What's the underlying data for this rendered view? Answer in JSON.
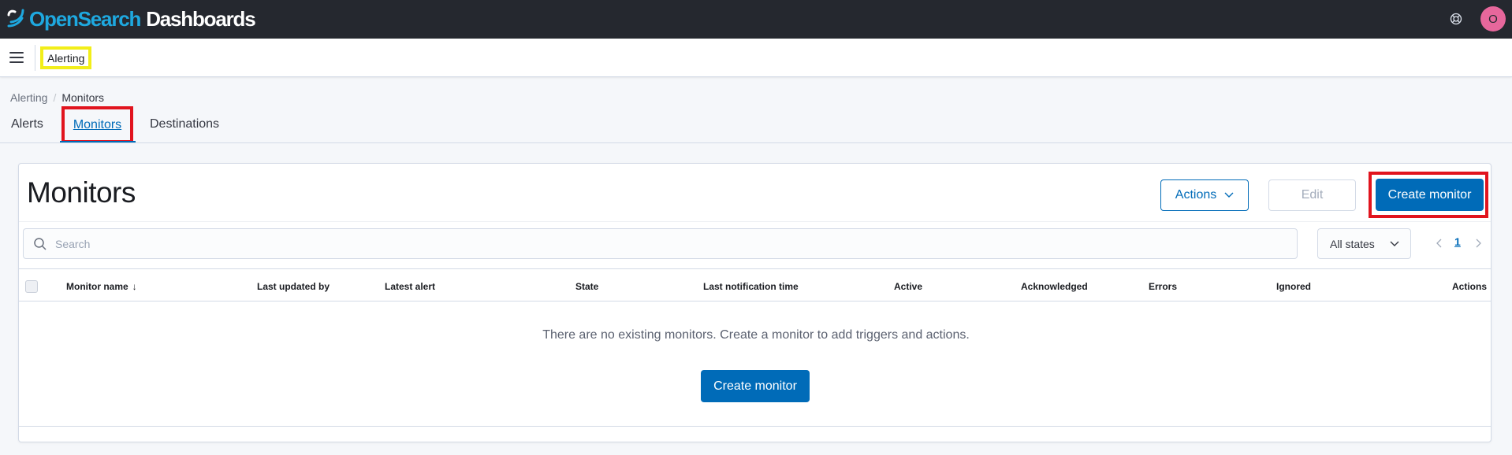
{
  "app": {
    "logo_open": "Open",
    "logo_search": "Search",
    "logo_dashboards": "Dashboards",
    "avatar_initial": "O",
    "brand_color": "#1ea8df",
    "header_bg": "#25282f",
    "avatar_color": "#e7679c"
  },
  "subheader": {
    "app_name": "Alerting"
  },
  "breadcrumb": {
    "items": [
      "Alerting",
      "Monitors"
    ]
  },
  "tabs": [
    {
      "label": "Alerts",
      "selected": false
    },
    {
      "label": "Monitors",
      "selected": true
    },
    {
      "label": "Destinations",
      "selected": false
    }
  ],
  "panel": {
    "title": "Monitors",
    "actions_label": "Actions",
    "edit_label": "Edit",
    "create_label": "Create monitor",
    "accent_color": "#006bb8"
  },
  "filters": {
    "search_placeholder": "Search",
    "search_value": "",
    "state_selected": "All states",
    "current_page": "1"
  },
  "table": {
    "columns": [
      "Monitor name",
      "Last updated by",
      "Latest alert",
      "State",
      "Last notification time",
      "Active",
      "Acknowledged",
      "Errors",
      "Ignored",
      "Actions"
    ],
    "sort_column": "Monitor name",
    "sort_direction": "desc",
    "rows": []
  },
  "empty_state": {
    "message": "There are no existing monitors. Create a monitor to add triggers and actions.",
    "button_label": "Create monitor"
  }
}
